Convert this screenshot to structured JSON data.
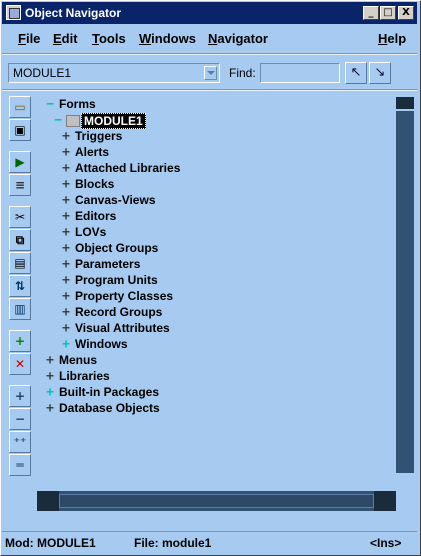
{
  "window": {
    "title": "Object Navigator"
  },
  "titlebar_buttons": {
    "minimize": "_",
    "maximize": "□",
    "close": "X"
  },
  "menu": [
    {
      "label": "File",
      "accel": "F"
    },
    {
      "label": "Edit",
      "accel": "E"
    },
    {
      "label": "Tools",
      "accel": "T"
    },
    {
      "label": "Windows",
      "accel": "W"
    },
    {
      "label": "Navigator",
      "accel": "N"
    },
    {
      "label": "Help",
      "accel": "H"
    }
  ],
  "module_combo": {
    "value": "MODULE1"
  },
  "find": {
    "label": "Find:",
    "value": ""
  },
  "find_buttons": [
    "find-previous-icon",
    "find-next-icon"
  ],
  "vertical_toolbar": [
    {
      "icon": "open-icon"
    },
    {
      "icon": "save-icon"
    },
    {
      "icon": "run-icon"
    },
    {
      "icon": "compile-icon"
    },
    {
      "icon": "cut-icon"
    },
    {
      "icon": "copy-icon"
    },
    {
      "icon": "paste-icon"
    },
    {
      "icon": "copy-properties-icon"
    },
    {
      "icon": "paste-properties-icon"
    },
    {
      "icon": "create-icon"
    },
    {
      "icon": "delete-icon"
    },
    {
      "icon": "expand-icon"
    },
    {
      "icon": "collapse-icon"
    },
    {
      "icon": "expand-all-icon"
    },
    {
      "icon": "collapse-all-icon"
    }
  ],
  "tree": {
    "root": {
      "label": "Forms",
      "state": "expanded"
    },
    "module": {
      "label": "MODULE1",
      "state": "expanded",
      "selected": true
    },
    "module_children": [
      {
        "label": "Triggers",
        "state": "collapsed"
      },
      {
        "label": "Alerts",
        "state": "collapsed"
      },
      {
        "label": "Attached Libraries",
        "state": "collapsed"
      },
      {
        "label": "Blocks",
        "state": "collapsed"
      },
      {
        "label": "Canvas-Views",
        "state": "collapsed"
      },
      {
        "label": "Editors",
        "state": "collapsed"
      },
      {
        "label": "LOVs",
        "state": "collapsed"
      },
      {
        "label": "Object Groups",
        "state": "collapsed"
      },
      {
        "label": "Parameters",
        "state": "collapsed"
      },
      {
        "label": "Program Units",
        "state": "collapsed"
      },
      {
        "label": "Property Classes",
        "state": "collapsed"
      },
      {
        "label": "Record Groups",
        "state": "collapsed"
      },
      {
        "label": "Visual Attributes",
        "state": "collapsed"
      },
      {
        "label": "Windows",
        "state": "has-children"
      }
    ],
    "top_level": [
      {
        "label": "Menus",
        "state": "collapsed"
      },
      {
        "label": "Libraries",
        "state": "collapsed"
      },
      {
        "label": "Built-in Packages",
        "state": "has-children"
      },
      {
        "label": "Database Objects",
        "state": "collapsed"
      }
    ]
  },
  "status": {
    "mod": "Mod: MODULE1",
    "file": "File: module1",
    "mode": "<Ins>"
  },
  "colors": {
    "background": "#a6caf0",
    "titlebar": "#0a246a",
    "selection": "#000000",
    "expand_marker": "#00c0c0"
  }
}
